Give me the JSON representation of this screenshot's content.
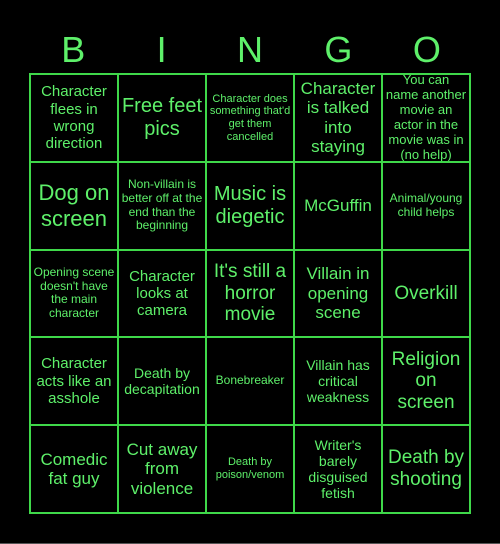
{
  "header": {
    "letters": [
      "B",
      "I",
      "N",
      "G",
      "O"
    ]
  },
  "colors": {
    "background": "#000000",
    "text": "#5ef06a",
    "border": "#3fd84a"
  },
  "cells": [
    "Character flees in wrong direction",
    "Free feet pics",
    "Character does something that'd get them cancelled",
    "Character is talked into staying",
    "You can name another movie an actor in the movie was in (no help)",
    "Dog on screen",
    "Non-villain is better off at the end than the beginning",
    "Music is diegetic",
    "McGuffin",
    "Animal/young child helps",
    "Opening scene doesn't have the main character",
    "Character looks at camera",
    "It's still a horror movie",
    "Villain in opening scene",
    "Overkill",
    "Character acts like an asshole",
    "Death by decapitation",
    "Bonebreaker",
    "Villain has critical weakness",
    "Religion on screen",
    "Comedic fat guy",
    "Cut away from violence",
    "Death by poison/venom",
    "Writer's barely disguised fetish",
    "Death by shooting"
  ]
}
